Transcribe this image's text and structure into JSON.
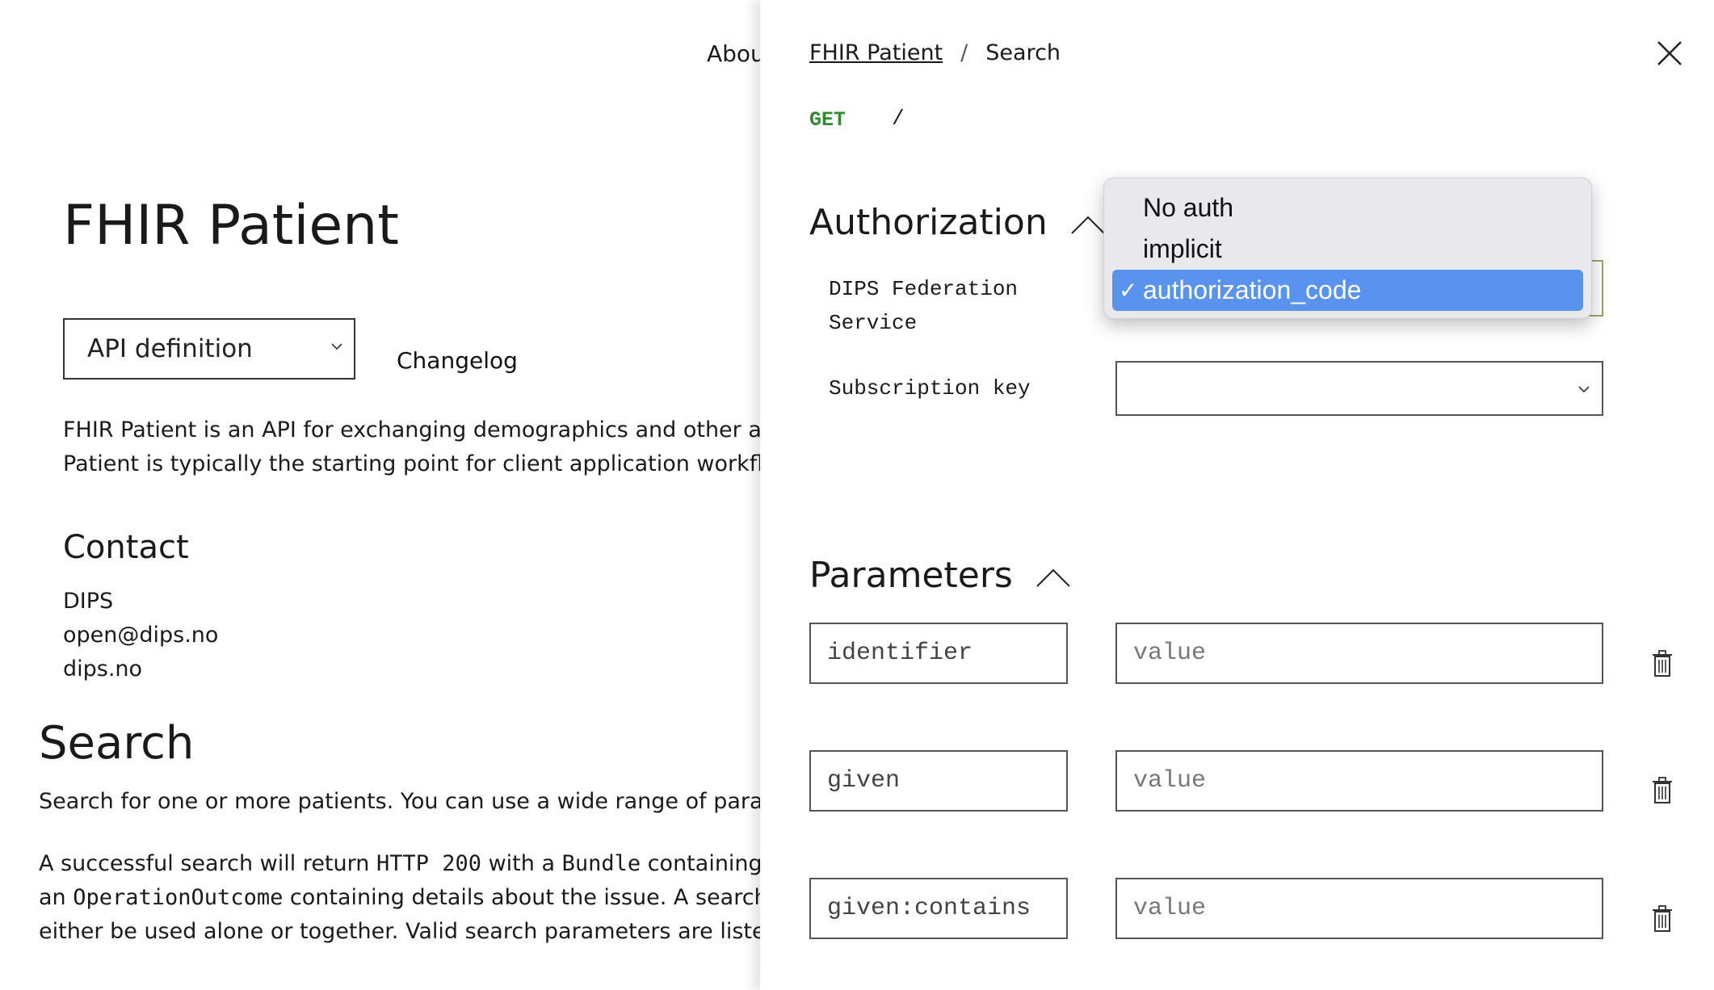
{
  "left": {
    "nav_about": "Abou",
    "title": "FHIR Patient",
    "api_select_value": "API definition",
    "changelog": "Changelog",
    "description_lines": [
      "FHIR Patient is an API for exchanging demographics and other administ",
      "Patient is typically the starting point for client application workflows, an"
    ],
    "contact_heading": "Contact",
    "contact": [
      "DIPS",
      "open@dips.no",
      "dips.no"
    ],
    "search_heading": "Search",
    "search_desc": "Search for one or more patients. You can use a wide range of parameters",
    "success": {
      "l1_a": "A successful search will return ",
      "l1_code1": "HTTP 200",
      "l1_b": " with a ",
      "l1_code2": "Bundle",
      "l1_c": " containing patie",
      "l2_a": "an ",
      "l2_code": "OperationOutcome",
      "l2_b": " containing details about the issue. A search with",
      "l3": "either be used alone or together. Valid search parameters are listed below"
    }
  },
  "drawer": {
    "breadcrumb": {
      "link": "FHIR Patient",
      "separator": "/",
      "current": "Search"
    },
    "method": "GET",
    "path": "/",
    "authorization": {
      "title": "Authorization",
      "dips_label": "DIPS Federation Service",
      "subscription_label": "Subscription key",
      "dropdown_options": [
        "No auth",
        "implicit",
        "authorization_code"
      ],
      "selected_option": "authorization_code",
      "check_mark": "✓"
    },
    "parameters": {
      "title": "Parameters",
      "rows": [
        {
          "name": "identifier",
          "value_placeholder": "value"
        },
        {
          "name": "given",
          "value_placeholder": "value"
        },
        {
          "name": "given:contains",
          "value_placeholder": "value"
        }
      ]
    }
  },
  "icons": {
    "close": "close-icon",
    "trash": "trash-icon",
    "caret_up": "chevron-up-icon",
    "chevron_down": "chevron-down-icon"
  },
  "colors": {
    "method_get": "#2e8b2e",
    "dropdown_selected": "#5a93ee",
    "dropdown_bg": "#e9e9eb"
  }
}
